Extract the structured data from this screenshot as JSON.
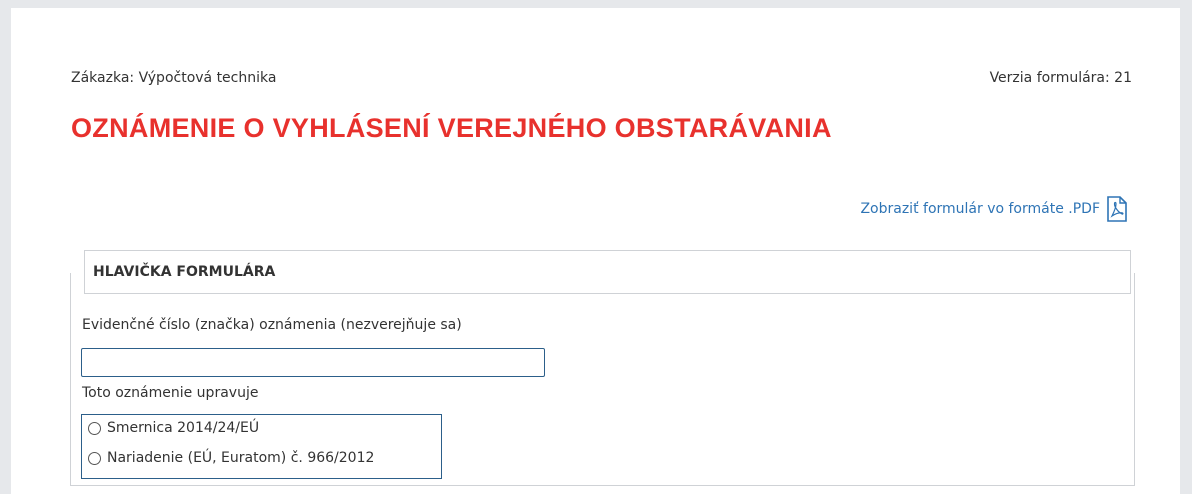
{
  "header": {
    "order_label": "Zákazka: Výpočtová technika",
    "form_version": "Verzia formulára: 21"
  },
  "title": "OZNÁMENIE O VYHLÁSENÍ VEREJNÉHO OBSTARÁVANIA",
  "pdf_link": {
    "label": "Zobraziť formulár vo formáte .PDF",
    "icon": "pdf-icon"
  },
  "form_header": {
    "section_title": "HLAVIČKA FORMULÁRA",
    "reference_label": "Evidenčné číslo (značka) oznámenia (nezverejňuje sa)",
    "reference_value": "",
    "regulation_label": "Toto oznámenie upravuje",
    "options": [
      {
        "label": "Smernica 2014/24/EÚ",
        "selected": false
      },
      {
        "label": "Nariadenie (EÚ, Euratom) č. 966/2012",
        "selected": false
      }
    ]
  },
  "colors": {
    "title_red": "#e8312d",
    "link_blue": "#2e74b5",
    "field_border": "#2c5f8a"
  }
}
